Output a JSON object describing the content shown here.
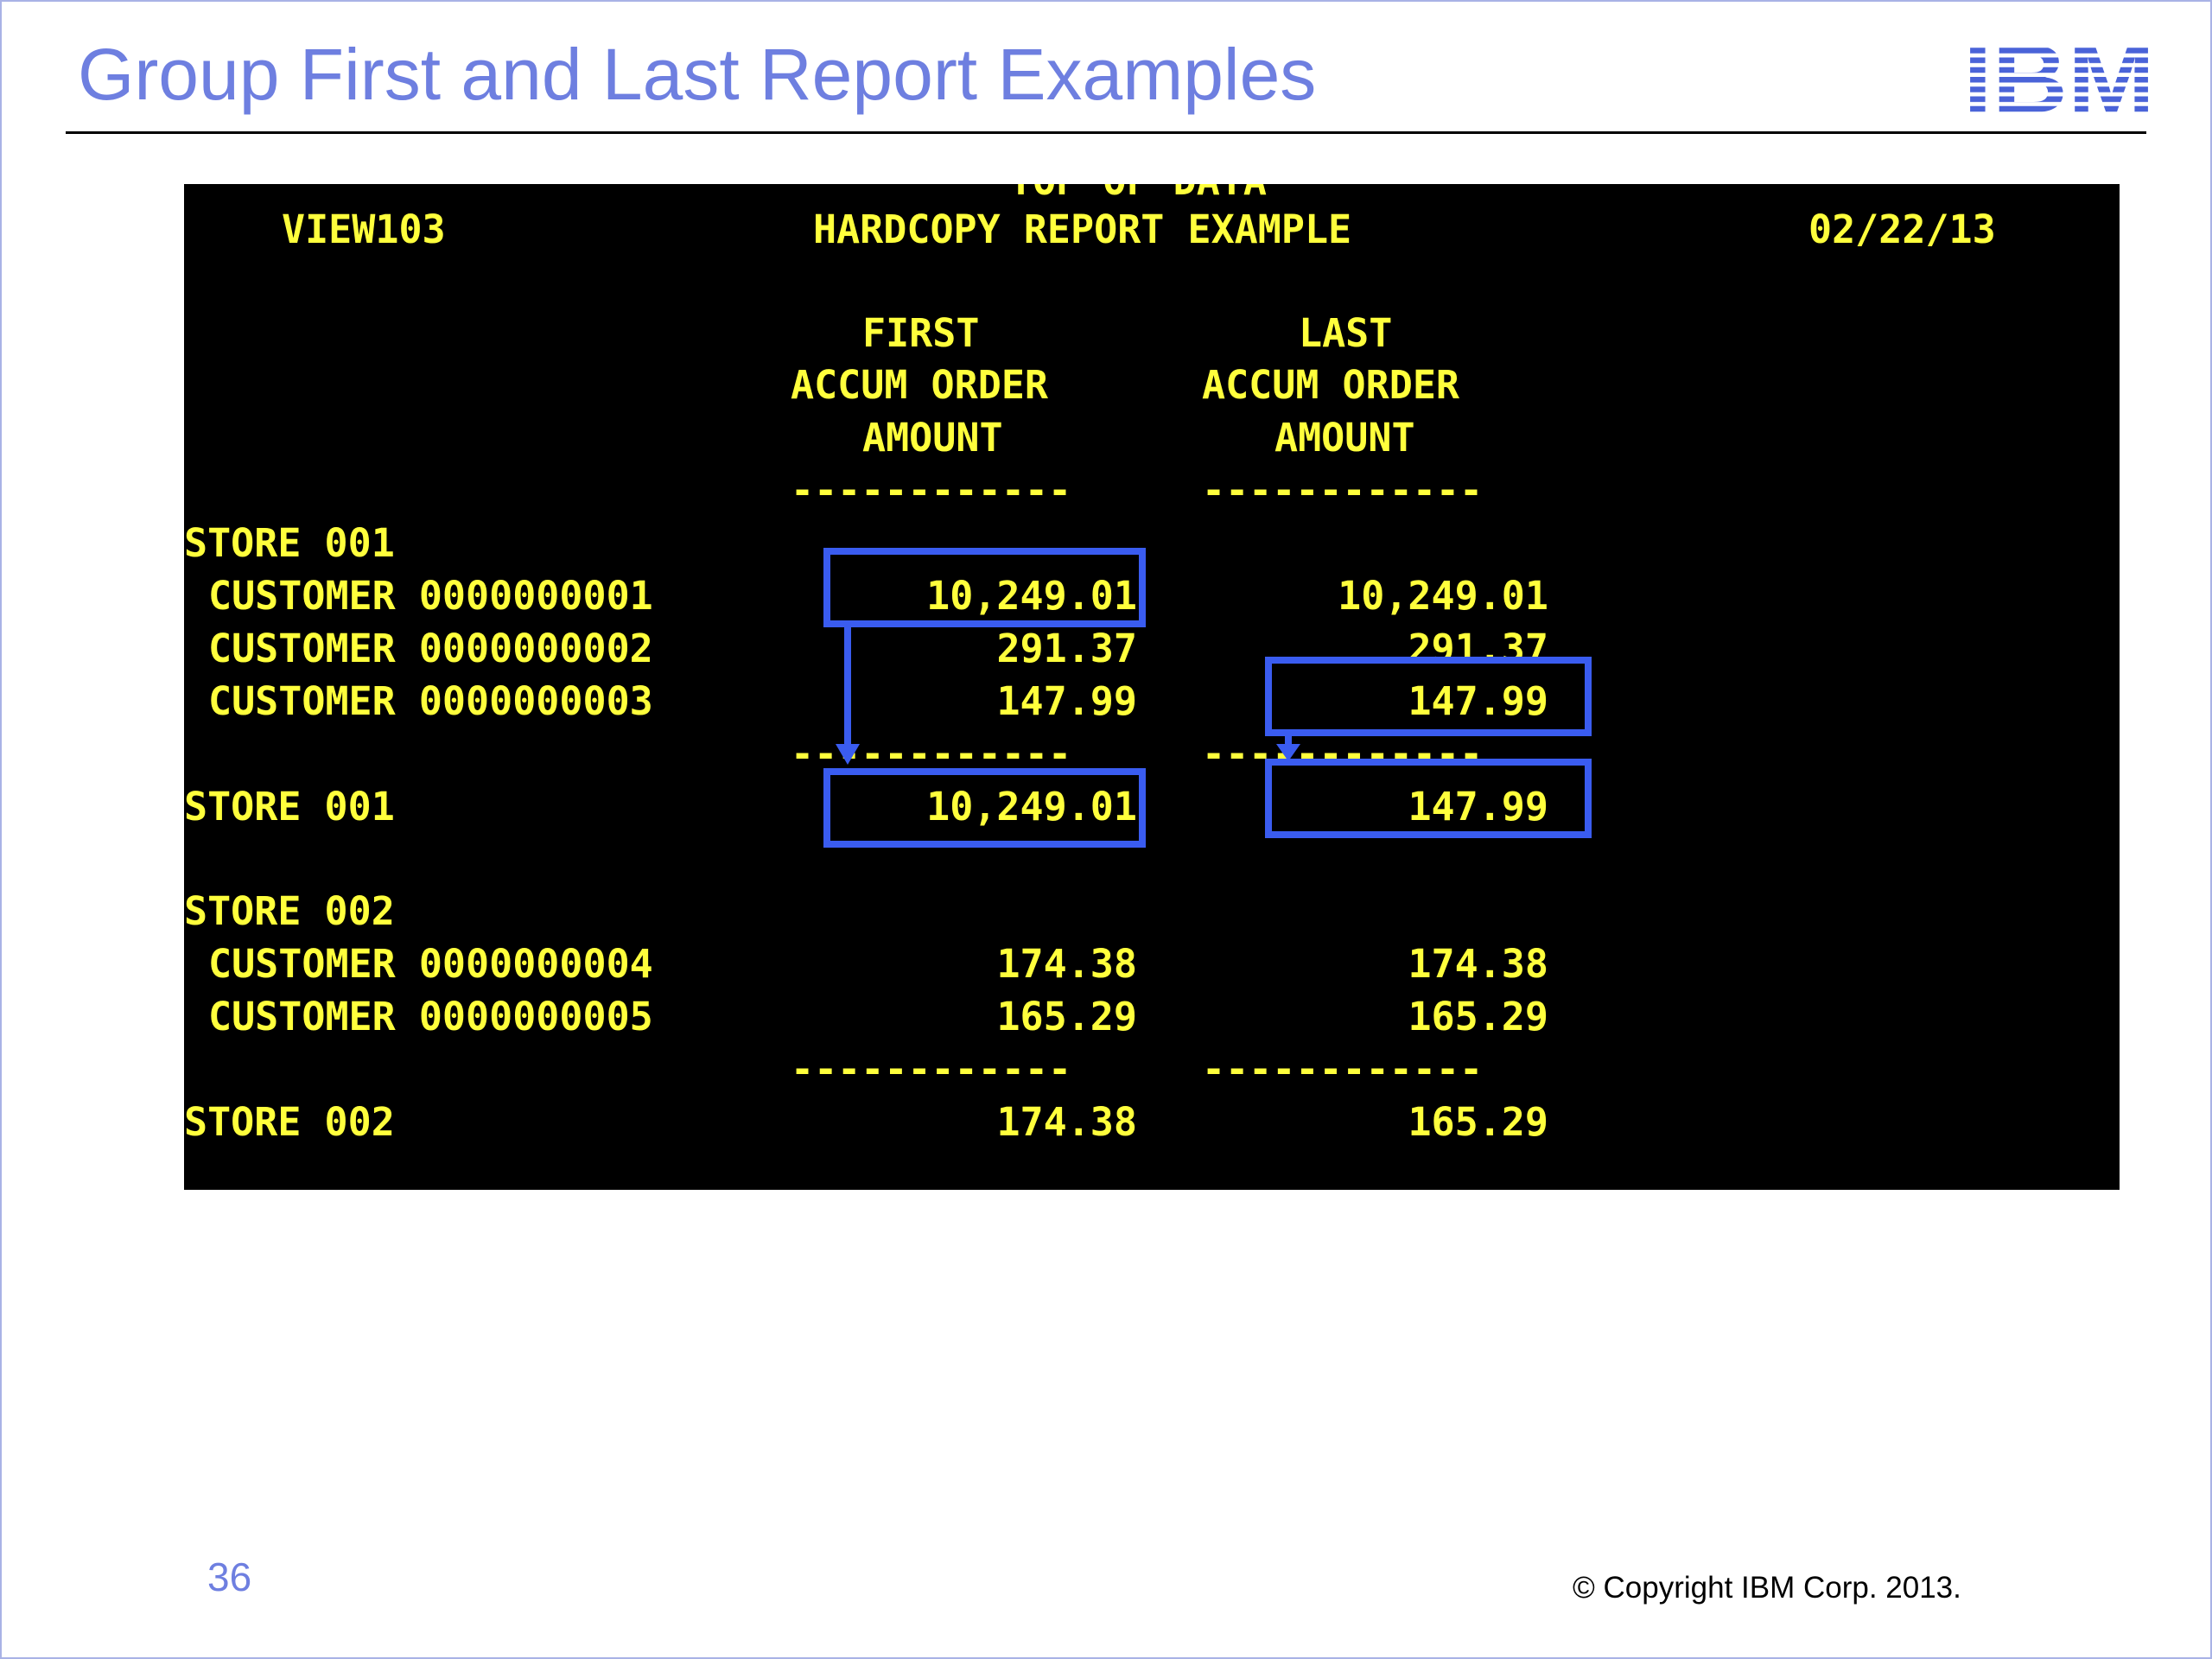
{
  "slide": {
    "title": "Group First and Last Report Examples",
    "logo_text": "IBM",
    "page_number": "36",
    "copyright": "© Copyright IBM Corp. 2013.",
    "colors": {
      "title": "#6e7fe0",
      "highlight": "#3a5cf0",
      "terminal_text": "#ffff3c",
      "terminal_bg": "#000000"
    }
  },
  "report": {
    "top_fragment": "TOP OF DATA",
    "view_id": "VIEW103",
    "report_title": "HARDCOPY REPORT EXAMPLE",
    "date": "02/22/13",
    "col_first": {
      "line1": "FIRST",
      "line2": "ACCUM ORDER",
      "line3": "AMOUNT"
    },
    "col_last": {
      "line1": "LAST",
      "line2": "ACCUM ORDER",
      "line3": "AMOUNT"
    },
    "separator": "------------",
    "groups": [
      {
        "header": "STORE 001",
        "rows": [
          {
            "label": "CUSTOMER 0000000001",
            "first": "10,249.01",
            "last": "10,249.01"
          },
          {
            "label": "CUSTOMER 0000000002",
            "first": "291.37",
            "last": "291.37"
          },
          {
            "label": "CUSTOMER 0000000003",
            "first": "147.99",
            "last": "147.99"
          }
        ],
        "total": {
          "label": "STORE 001",
          "first": "10,249.01",
          "last": "147.99"
        }
      },
      {
        "header": "STORE 002",
        "rows": [
          {
            "label": "CUSTOMER 0000000004",
            "first": "174.38",
            "last": "174.38"
          },
          {
            "label": "CUSTOMER 0000000005",
            "first": "165.29",
            "last": "165.29"
          }
        ],
        "total": {
          "label": "STORE 002",
          "first": "174.38",
          "last": "165.29"
        }
      }
    ]
  }
}
